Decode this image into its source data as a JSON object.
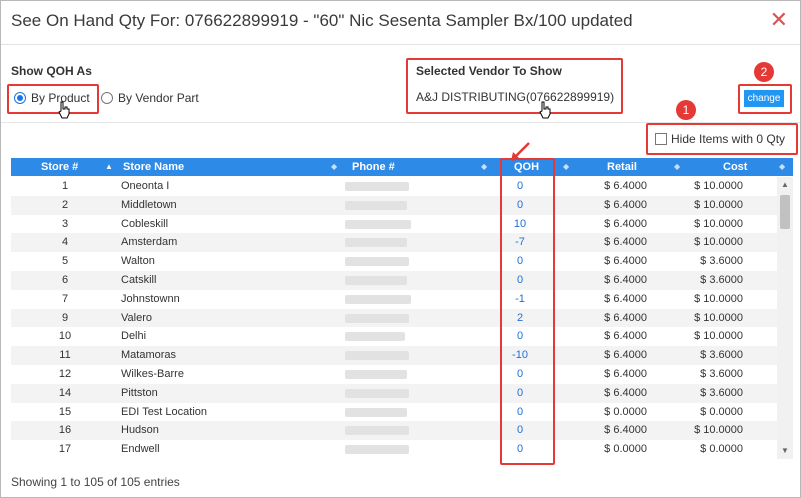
{
  "dialog": {
    "title": "See On Hand Qty For: 076622899919 - \"60\" Nic Sesenta Sampler Bx/100 updated",
    "close_glyph": "✕"
  },
  "qoh_as": {
    "label": "Show QOH As",
    "options": [
      {
        "label": "By Product",
        "selected": true
      },
      {
        "label": "By Vendor Part",
        "selected": false
      }
    ]
  },
  "vendor": {
    "label": "Selected Vendor To Show",
    "value": "A&J DISTRIBUTING(076622899919)"
  },
  "change_button": {
    "label": "change"
  },
  "hide_zero": {
    "label": "Hide Items with 0 Qty",
    "checked": false
  },
  "badges": {
    "one": "1",
    "two": "2"
  },
  "table": {
    "columns": [
      "Store #",
      "Store Name",
      "Phone #",
      "QOH",
      "Retail",
      "Cost"
    ],
    "rows": [
      {
        "store": "1",
        "name": "Oneonta I",
        "qoh": "0",
        "retail": "$ 6.4000",
        "cost": "$ 10.0000"
      },
      {
        "store": "2",
        "name": "Middletown",
        "qoh": "0",
        "retail": "$ 6.4000",
        "cost": "$ 10.0000"
      },
      {
        "store": "3",
        "name": "Cobleskill",
        "qoh": "10",
        "retail": "$ 6.4000",
        "cost": "$ 10.0000"
      },
      {
        "store": "4",
        "name": "Amsterdam",
        "qoh": "-7",
        "retail": "$ 6.4000",
        "cost": "$ 10.0000"
      },
      {
        "store": "5",
        "name": "Walton",
        "qoh": "0",
        "retail": "$ 6.4000",
        "cost": "$ 3.6000"
      },
      {
        "store": "6",
        "name": "Catskill",
        "qoh": "0",
        "retail": "$ 6.4000",
        "cost": "$ 3.6000"
      },
      {
        "store": "7",
        "name": "Johnstownn",
        "qoh": "-1",
        "retail": "$ 6.4000",
        "cost": "$ 10.0000"
      },
      {
        "store": "9",
        "name": "Valero",
        "qoh": "2",
        "retail": "$ 6.4000",
        "cost": "$ 10.0000"
      },
      {
        "store": "10",
        "name": "Delhi",
        "qoh": "0",
        "retail": "$ 6.4000",
        "cost": "$ 10.0000"
      },
      {
        "store": "11",
        "name": "Matamoras",
        "qoh": "-10",
        "retail": "$ 6.4000",
        "cost": "$ 3.6000"
      },
      {
        "store": "12",
        "name": "Wilkes-Barre",
        "qoh": "0",
        "retail": "$ 6.4000",
        "cost": "$ 3.6000"
      },
      {
        "store": "14",
        "name": "Pittston",
        "qoh": "0",
        "retail": "$ 6.4000",
        "cost": "$ 3.6000"
      },
      {
        "store": "15",
        "name": "EDI Test Location",
        "qoh": "0",
        "retail": "$ 0.0000",
        "cost": "$ 0.0000"
      },
      {
        "store": "16",
        "name": "Hudson",
        "qoh": "0",
        "retail": "$ 6.4000",
        "cost": "$ 10.0000"
      },
      {
        "store": "17",
        "name": "Endwell",
        "qoh": "0",
        "retail": "$ 0.0000",
        "cost": "$ 0.0000"
      }
    ]
  },
  "footer": {
    "text": "Showing 1 to 105 of 105 entries"
  },
  "colors": {
    "accent": "#2d8ae6",
    "annotation": "#e53935",
    "qoh_text": "#1e6fd9"
  }
}
